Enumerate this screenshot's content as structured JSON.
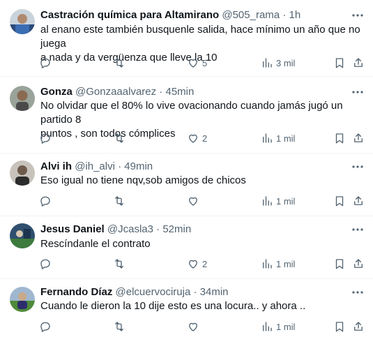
{
  "tweets": [
    {
      "name": "Castración química para Altamirano",
      "handle": "@505_rama",
      "separator": "·",
      "time": "1h",
      "text_lines": [
        "al enano este también busquenle salida, hace mínimo un año que no juega",
        "a nada y da vergüenza que lleve la 10"
      ],
      "reply_count": "",
      "retweet_count": "",
      "like_count": "5",
      "view_count": "3 mil",
      "avatar_icon": "avatar-blue-jersey"
    },
    {
      "name": "Gonza",
      "handle": "@Gonzaaalvarez",
      "separator": "·",
      "time": "45min",
      "text_lines": [
        "No olvidar que el 80% lo vive ovacionando cuando jamás jugó un partido 8",
        "puntos , son todos cómplices"
      ],
      "reply_count": "",
      "retweet_count": "",
      "like_count": "2",
      "view_count": "1 mil",
      "avatar_icon": "avatar-man-portrait"
    },
    {
      "name": "Alvi ih",
      "handle": "@ih_alvi",
      "separator": "·",
      "time": "49min",
      "text_lines": [
        "Eso igual no tiene nqv,sob amigos de chicos"
      ],
      "reply_count": "",
      "retweet_count": "",
      "like_count": "",
      "view_count": "1 mil",
      "avatar_icon": "avatar-portrait"
    },
    {
      "name": "Jesus Daniel",
      "handle": "@Jcasla3",
      "separator": "·",
      "time": "52min",
      "text_lines": [
        "Rescíndanle el contrato"
      ],
      "reply_count": "",
      "retweet_count": "",
      "like_count": "2",
      "view_count": "1 mil",
      "avatar_icon": "avatar-stadium"
    },
    {
      "name": "Fernando Díaz",
      "handle": "@elcuervociruja",
      "separator": "·",
      "time": "34min",
      "text_lines": [
        "Cuando le dieron  la 10 dije esto es una locura.. y ahora .."
      ],
      "reply_count": "",
      "retweet_count": "",
      "like_count": "",
      "view_count": "1 mil",
      "avatar_icon": "avatar-field"
    }
  ],
  "colors": {
    "text": "#0f1419",
    "muted": "#536471",
    "border": "#eff3f4"
  }
}
